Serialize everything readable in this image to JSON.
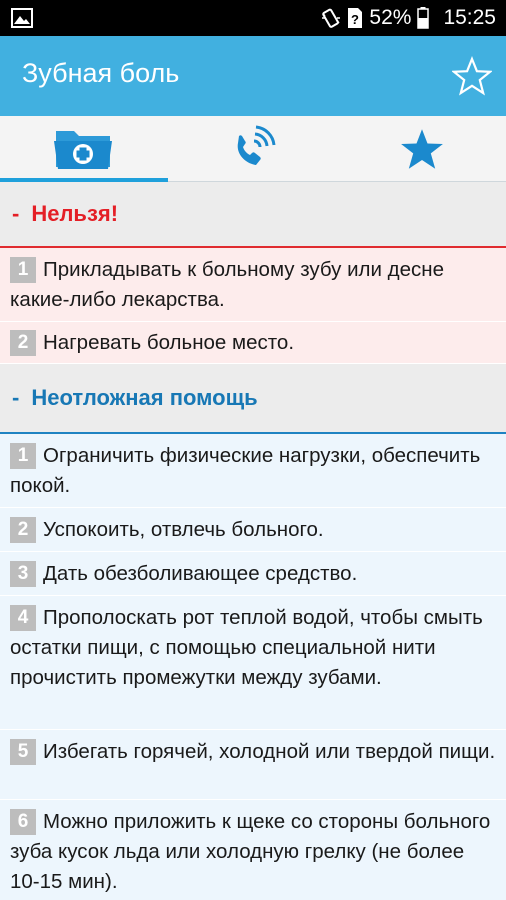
{
  "status_bar": {
    "battery_percent": "52%",
    "time": "15:25",
    "icons": [
      "gallery-icon",
      "vibrate-icon",
      "no-sim-icon",
      "battery-icon"
    ]
  },
  "action_bar": {
    "title": "Зубная боль",
    "favorite_icon": "star-outline-icon"
  },
  "tabs": [
    {
      "icon": "medical-folder-icon",
      "selected": true
    },
    {
      "icon": "phone-call-icon",
      "selected": false
    },
    {
      "icon": "star-icon",
      "selected": false
    }
  ],
  "colors": {
    "action_bar": "#41b0e0",
    "forbid_text": "#e41f26",
    "help_text": "#1878b5",
    "forbid_row": "#fdecec",
    "help_row": "#edf6fd",
    "tab_indicator": "#1fa0db"
  },
  "sections": {
    "forbidden": {
      "title": "Нельзя!",
      "dash": "-",
      "items": [
        {
          "num": "1",
          "text": "Прикладывать к больному зубу или десне какие-либо лекарства."
        },
        {
          "num": "2",
          "text": "Нагревать больное место."
        }
      ]
    },
    "first_aid": {
      "title": "Неотложная помощь",
      "dash": "-",
      "items": [
        {
          "num": "1",
          "text": "Ограничить физические нагрузки, обеспечить покой."
        },
        {
          "num": "2",
          "text": "Успокоить, отвлечь больного."
        },
        {
          "num": "3",
          "text": "Дать обезболивающее средство."
        },
        {
          "num": "4",
          "text": "Прополоскать рот теплой водой, чтобы смыть остатки пищи, с помощью специальной нити прочистить промежутки между зубами."
        },
        {
          "num": "5",
          "text": "Избегать горячей, холодной или твердой пищи."
        },
        {
          "num": "6",
          "text": "Можно приложить к щеке со стороны больного зуба кусок льда или холодную грелку (не более 10-15 мин)."
        }
      ]
    }
  }
}
